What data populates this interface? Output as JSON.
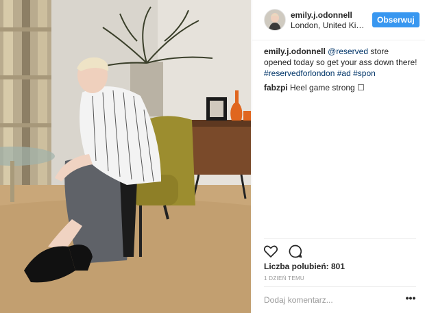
{
  "post": {
    "username": "emily.j.odonnell",
    "location": "London, United Kingdom",
    "follow_label": "Obserwuj",
    "caption": {
      "username": "emily.j.odonnell",
      "mention": "@reserved",
      "text_after_mention": "store opened today so get your ass down there!",
      "hashtags": "#reservedforlondon #ad #spon"
    },
    "comment": {
      "username": "fabzpi",
      "text": "Heel game strong ☐"
    },
    "likes_label": "Liczba polubień: 801",
    "time_ago": "1 DZIEŃ TEMU",
    "add_comment_placeholder": "Dodaj komentarz...",
    "more_label": "•••"
  },
  "icons": {
    "like": "heart-icon",
    "comment": "comment-bubble-icon",
    "more": "more-options-icon"
  },
  "colors": {
    "follow_button": "#3897f0",
    "link": "#003569",
    "secondary_text": "#999999",
    "divider": "#efefef"
  }
}
